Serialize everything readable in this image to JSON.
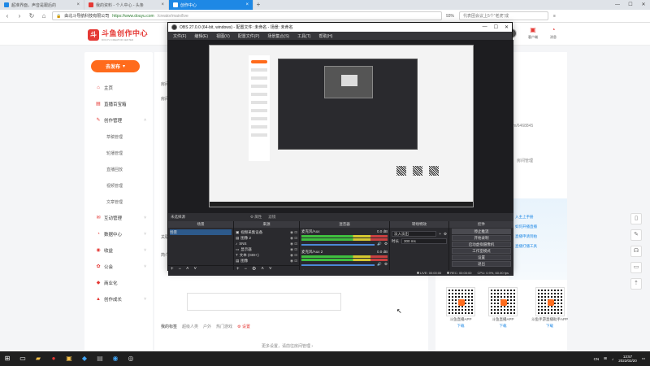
{
  "browser": {
    "tabs": [
      {
        "title": "超准界面，声音是跟后的",
        "color": "#1e88e5",
        "active": false
      },
      {
        "title": "我的资料 - 个人中心 - 头条",
        "color": "#e53935",
        "active": false
      },
      {
        "title": "创作中心",
        "color": "#ffffff",
        "active": true
      }
    ],
    "new_tab": "+",
    "address": {
      "site": "由北斗导航科技有限公司",
      "host": "https://www.douyu.com",
      "path": "/creator/main/live"
    },
    "zoom": "93%",
    "search_text": "代表团会议上5个“老虎”成",
    "window_controls": [
      "—",
      "☐",
      "✕"
    ]
  },
  "header": {
    "logo_text": "斗鱼创作中心",
    "logo_sub": "DOUYU CREATOR CENTER",
    "items": [
      {
        "label": "客户端"
      },
      {
        "label": "消息"
      }
    ]
  },
  "sidebar": {
    "publish_label": "去发布",
    "items": [
      {
        "label": "主页",
        "icon": "home-icon",
        "type": "item"
      },
      {
        "label": "直播百宝箱",
        "icon": "toolbox-icon",
        "type": "item"
      },
      {
        "label": "创作管理",
        "icon": "edit-icon",
        "type": "item",
        "expand": true
      },
      {
        "label": "草稿管理",
        "type": "sub"
      },
      {
        "label": "轮播管理",
        "type": "sub"
      },
      {
        "label": "直播回放",
        "type": "sub"
      },
      {
        "label": "视频管理",
        "type": "sub"
      },
      {
        "label": "文章管理",
        "type": "sub"
      },
      {
        "label": "互动管理",
        "icon": "chat-icon",
        "type": "item",
        "expand": true
      },
      {
        "label": "数据中心",
        "icon": "chart-icon",
        "type": "item",
        "expand": true
      },
      {
        "label": "收益",
        "icon": "coin-icon",
        "type": "item",
        "expand": true
      },
      {
        "label": "公会",
        "icon": "group-icon",
        "type": "item",
        "expand": true
      },
      {
        "label": "商业化",
        "icon": "business-icon",
        "type": "item"
      },
      {
        "label": "创作成长",
        "icon": "growth-icon",
        "type": "item",
        "expand": true
      }
    ]
  },
  "content": {
    "labels": [
      "房间",
      "房间",
      "关联",
      "简介"
    ],
    "tags_label": "我的标签",
    "tags": [
      "超级人类",
      "户外",
      "热门游戏"
    ],
    "settings_link": "设置",
    "more_settings": "更多设置，请前往房间管理 ›"
  },
  "right": {
    "room_id": "room/6468845",
    "room_manage": "房间管理",
    "banner_lines": [
      "入主上手册",
      "如何开播直播",
      "直播申请到拍",
      "直播打播工具"
    ],
    "qr_codes": [
      {
        "name": "斗鱼直播APP",
        "action": "下载"
      },
      {
        "name": "斗鱼直播APP",
        "action": "下载"
      },
      {
        "name": "斗鱼手游直播助手APP",
        "action": "下载"
      }
    ]
  },
  "obs": {
    "title": "OBS 27.0.0 (64-bit, windows) - 配置文件: 未命名 - 场景: 未命名",
    "menu": [
      "文件(F)",
      "编辑(E)",
      "视图(V)",
      "配置文件(P)",
      "场景集合(S)",
      "工具(T)",
      "帮助(H)"
    ],
    "no_source": "未选择源",
    "props_btn": "⚙ 属性",
    "filter_btn": "滤镜",
    "docks": {
      "scenes_title": "场景",
      "sources_title": "来源",
      "mixer_title": "混音器",
      "transitions_title": "转场特效",
      "controls_title": "控件"
    },
    "scenes": [
      "场景"
    ],
    "sources": [
      "视频采集设备",
      "图像 2",
      "SNS",
      "显示器",
      "文本 (GDI+)",
      "图像"
    ],
    "mixer": [
      {
        "name": "麦克风/Aux",
        "db": "0.0 dB"
      },
      {
        "name": "麦克风/Aux 2",
        "db": "0.0 dB"
      }
    ],
    "mixer_bottom": "桌面音频",
    "transitions": {
      "type": "淡入淡出",
      "duration_label": "时长",
      "duration": "300 ms"
    },
    "controls": [
      "停止推流",
      "开始录制",
      "启动虚拟摄像机",
      "工作室模式",
      "设置",
      "退出"
    ],
    "status": {
      "live": "LIVE: 00:00:00",
      "rec": "REC: 00:00:00",
      "cpu": "CPU: 0.9%, 60.00 fps"
    }
  },
  "taskbar": {
    "tray_lang": "CN",
    "time": "13:57",
    "date": "2022/02/20"
  }
}
